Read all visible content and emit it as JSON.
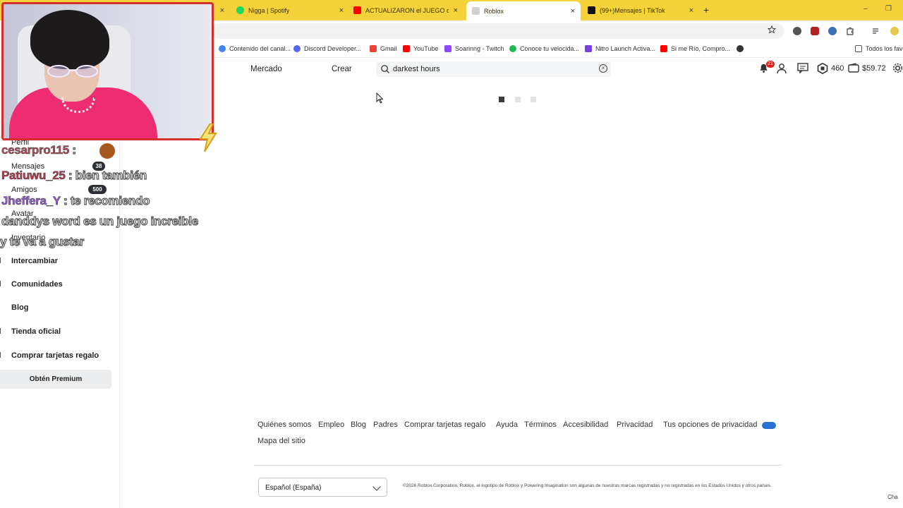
{
  "browser": {
    "tabs": [
      {
        "title": "Nigga | Spotify",
        "icon": "spotify-icon",
        "color": "#1ed760"
      },
      {
        "title": "ACTUALIZARON el JUEGO de P",
        "icon": "youtube-icon",
        "color": "#ff0000"
      },
      {
        "title": "Roblox",
        "icon": "roblox-icon",
        "color": "#cccccc",
        "active": true
      },
      {
        "title": "(99+)Mensajes | TikTok",
        "icon": "tiktok-icon",
        "color": "#111111"
      }
    ],
    "close_glyph": "×",
    "new_tab_glyph": "+",
    "minimize_glyph": "–",
    "restore_glyph": "❐"
  },
  "bookmarks": [
    {
      "label": "Contenido del canal...",
      "icon": "google-icon",
      "color": "#4285f4"
    },
    {
      "label": "Discord Developer...",
      "icon": "discord-icon",
      "color": "#5865f2"
    },
    {
      "label": "Gmail",
      "icon": "gmail-icon",
      "color": "#ea4335"
    },
    {
      "label": "YouTube",
      "icon": "youtube-icon",
      "color": "#ff0000"
    },
    {
      "label": "Soarinng - Twitch",
      "icon": "twitch-icon",
      "color": "#9146ff"
    },
    {
      "label": "Conoce tu velocida...",
      "icon": "speedtest-icon",
      "color": "#1db954"
    },
    {
      "label": "Nitro Launch Activa...",
      "icon": "nitro-icon",
      "color": "#7b3fe4"
    },
    {
      "label": "Si me Río, Compro...",
      "icon": "youtube-icon",
      "color": "#ff0000"
    }
  ],
  "bookmarks_folder": "Todos los favo",
  "header": {
    "nav": [
      "Mercado",
      "Crear"
    ],
    "search_value": "darkest hours",
    "notification_count": "21",
    "robux": "460",
    "money": "$59.72"
  },
  "sidebar": {
    "items": [
      {
        "label": "Perfil"
      },
      {
        "label": "Mensajes",
        "badge": "38"
      },
      {
        "label": "Amigos",
        "badge": "500"
      },
      {
        "label": "Avatar"
      },
      {
        "label": "Inventario"
      },
      {
        "label": "Intercambiar"
      },
      {
        "label": "Comunidades"
      },
      {
        "label": "Blog"
      },
      {
        "label": "Tienda oficial"
      },
      {
        "label": "Comprar tarjetas regalo"
      }
    ],
    "premium_label": "Obtén Premium"
  },
  "chat": [
    {
      "user": "cesarpro115",
      "sep": " : ",
      "message": "",
      "color": "#c44a5a"
    },
    {
      "user": "Patiuwu_25",
      "sep": " : ",
      "message": "bien también",
      "color": "#c4344a"
    },
    {
      "user": "Jheffera_Y",
      "sep": " : ",
      "message": "te recomiendo",
      "color": "#9b59e6"
    },
    {
      "user": "",
      "sep": "",
      "message": "danddys word es un juego increible",
      "color": "#ffffff"
    },
    {
      "user": "",
      "sep": "",
      "message": "y te va a gustar",
      "color": "#ffffff"
    }
  ],
  "footer": {
    "links": [
      "Quiénes somos",
      "Empleo",
      "Blog",
      "Padres",
      "Comprar tarjetas regalo",
      "Ayuda",
      "Términos",
      "Accesibilidad",
      "Privacidad",
      "Tus opciones de privacidad"
    ],
    "sitemap": "Mapa del sitio",
    "language": "Español (España)",
    "copyright": "©2026 Roblox Corporation. Roblox, el logotipo de Roblox y Powering Imagination son algunas de nuestras marcas registradas y no registradas en los Estados Unidos y otros países."
  },
  "chat_widget_label": "Cha"
}
